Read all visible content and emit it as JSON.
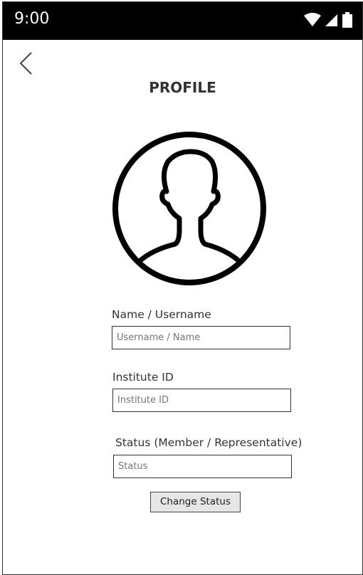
{
  "status_bar": {
    "time": "9:00",
    "icons": [
      "wifi-icon",
      "cellular-signal-icon",
      "battery-icon"
    ]
  },
  "nav": {
    "back_icon": "chevron-left-icon"
  },
  "page": {
    "title": "PROFILE"
  },
  "avatar": {
    "icon": "user-avatar-icon"
  },
  "form": {
    "name": {
      "label": "Name / Username",
      "placeholder": "Username / Name"
    },
    "institute": {
      "label": "Institute ID",
      "placeholder": "Institute ID"
    },
    "status": {
      "label": "Status (Member / Representative)",
      "placeholder": "Status"
    },
    "change_status_label": "Change Status"
  }
}
